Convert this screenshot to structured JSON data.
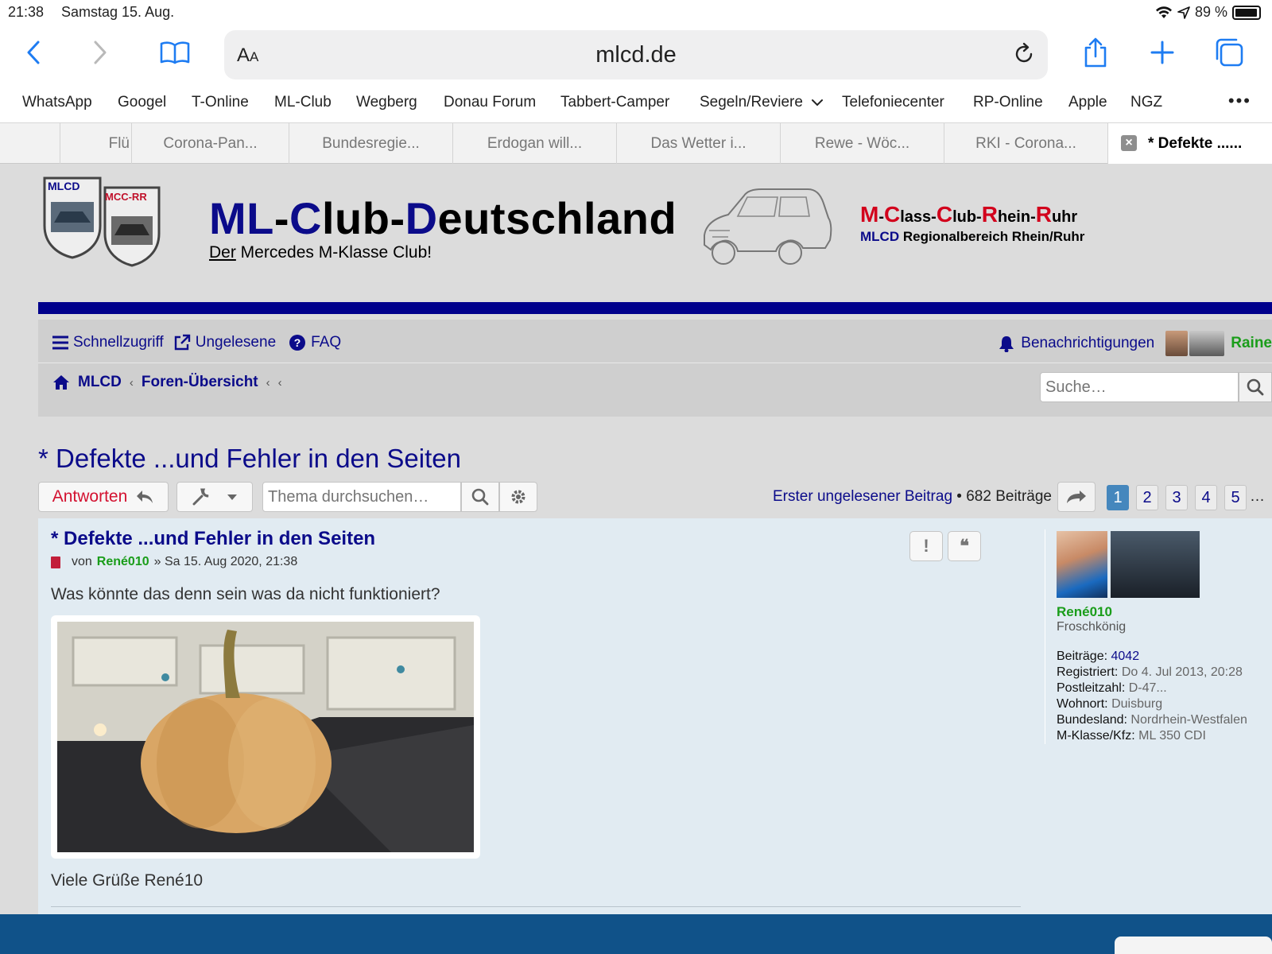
{
  "status_bar": {
    "time": "21:38",
    "date": "Samstag 15. Aug.",
    "battery": "89 %"
  },
  "browser": {
    "text_size_label": "AA",
    "url": "mlcd.de",
    "favorites": [
      "WhatsApp",
      "Googel",
      "T-Online",
      "ML-Club",
      "Wegberg",
      "Donau Forum",
      "Tabbert-Camper",
      "Segeln/Reviere",
      "Telefoniecenter",
      "RP-Online",
      "Apple",
      "NGZ"
    ],
    "tabs": [
      "Flü",
      "Corona-Pan...",
      "Bundesregie...",
      "Erdogan will...",
      "Das Wetter i...",
      "Rewe - Wöc...",
      "RKI - Corona...",
      "* Defekte ......"
    ]
  },
  "site": {
    "logo1_text": "MLCD",
    "logo2_text": "MCC-RR",
    "title": {
      "p1": "ML",
      "p2": "-",
      "p3": "C",
      "p4": "lub-",
      "p5": "D",
      "p6": "eutschland"
    },
    "subtitle": {
      "underlined": "Der",
      "rest": " Mercedes M-Klasse Club!"
    },
    "mccr": {
      "m": "M",
      "d1": "-",
      "c1": "C",
      "lass": "lass-",
      "c2": "C",
      "lub": "lub-",
      "r1": "R",
      "hein": "hein-",
      "r2": "R",
      "uhr": "uhr"
    },
    "mccr_sub": {
      "mlcd": "MLCD",
      "rest": " Regionalbereich Rhein/Ruhr"
    }
  },
  "nav": {
    "quick_access": "Schnellzugriff",
    "unread": "Ungelesene",
    "faq": "FAQ",
    "notifications": "Benachrichtigungen",
    "user": "Raine",
    "breadcrumb": [
      "MLCD",
      "Foren-Übersicht"
    ],
    "search_placeholder": "Suche…"
  },
  "topic": {
    "title": "* Defekte ...und Fehler in den Seiten",
    "reply_label": "Antworten",
    "search_placeholder": "Thema durchsuchen…",
    "first_unread": "Erster ungelesener Beitrag",
    "post_count": " • 682 Beiträge",
    "pages": [
      "1",
      "2",
      "3",
      "4",
      "5"
    ],
    "pages_more": "…"
  },
  "post": {
    "title": "* Defekte ...und Fehler in den Seiten",
    "by": "von",
    "author": "René010",
    "date": "» Sa 15. Aug 2020, 21:38",
    "report_label": "!",
    "quote_label": "❝",
    "body": "Was könnte das denn sein was da nicht funktioniert?",
    "signature": "Viele Grüße René10"
  },
  "profile": {
    "name": "René010",
    "rank": "Froschkönig",
    "fields": [
      {
        "k": "Beiträge:",
        "v": "4042"
      },
      {
        "k": "Registriert:",
        "v": "Do 4. Jul 2013, 20:28"
      },
      {
        "k": "Postleitzahl:",
        "v": "D-47..."
      },
      {
        "k": "Wohnort:",
        "v": "Duisburg"
      },
      {
        "k": "Bundesland:",
        "v": "Nordrhein-Westfalen"
      },
      {
        "k": "M-Klasse/Kfz:",
        "v": "ML 350 CDI"
      }
    ]
  },
  "colors": {
    "site_blue": "#0b0b8a",
    "accent_red": "#d31130",
    "user_green": "#1a9d1a",
    "footer_blue": "#105289",
    "post_bg": "#e1ebf2"
  }
}
